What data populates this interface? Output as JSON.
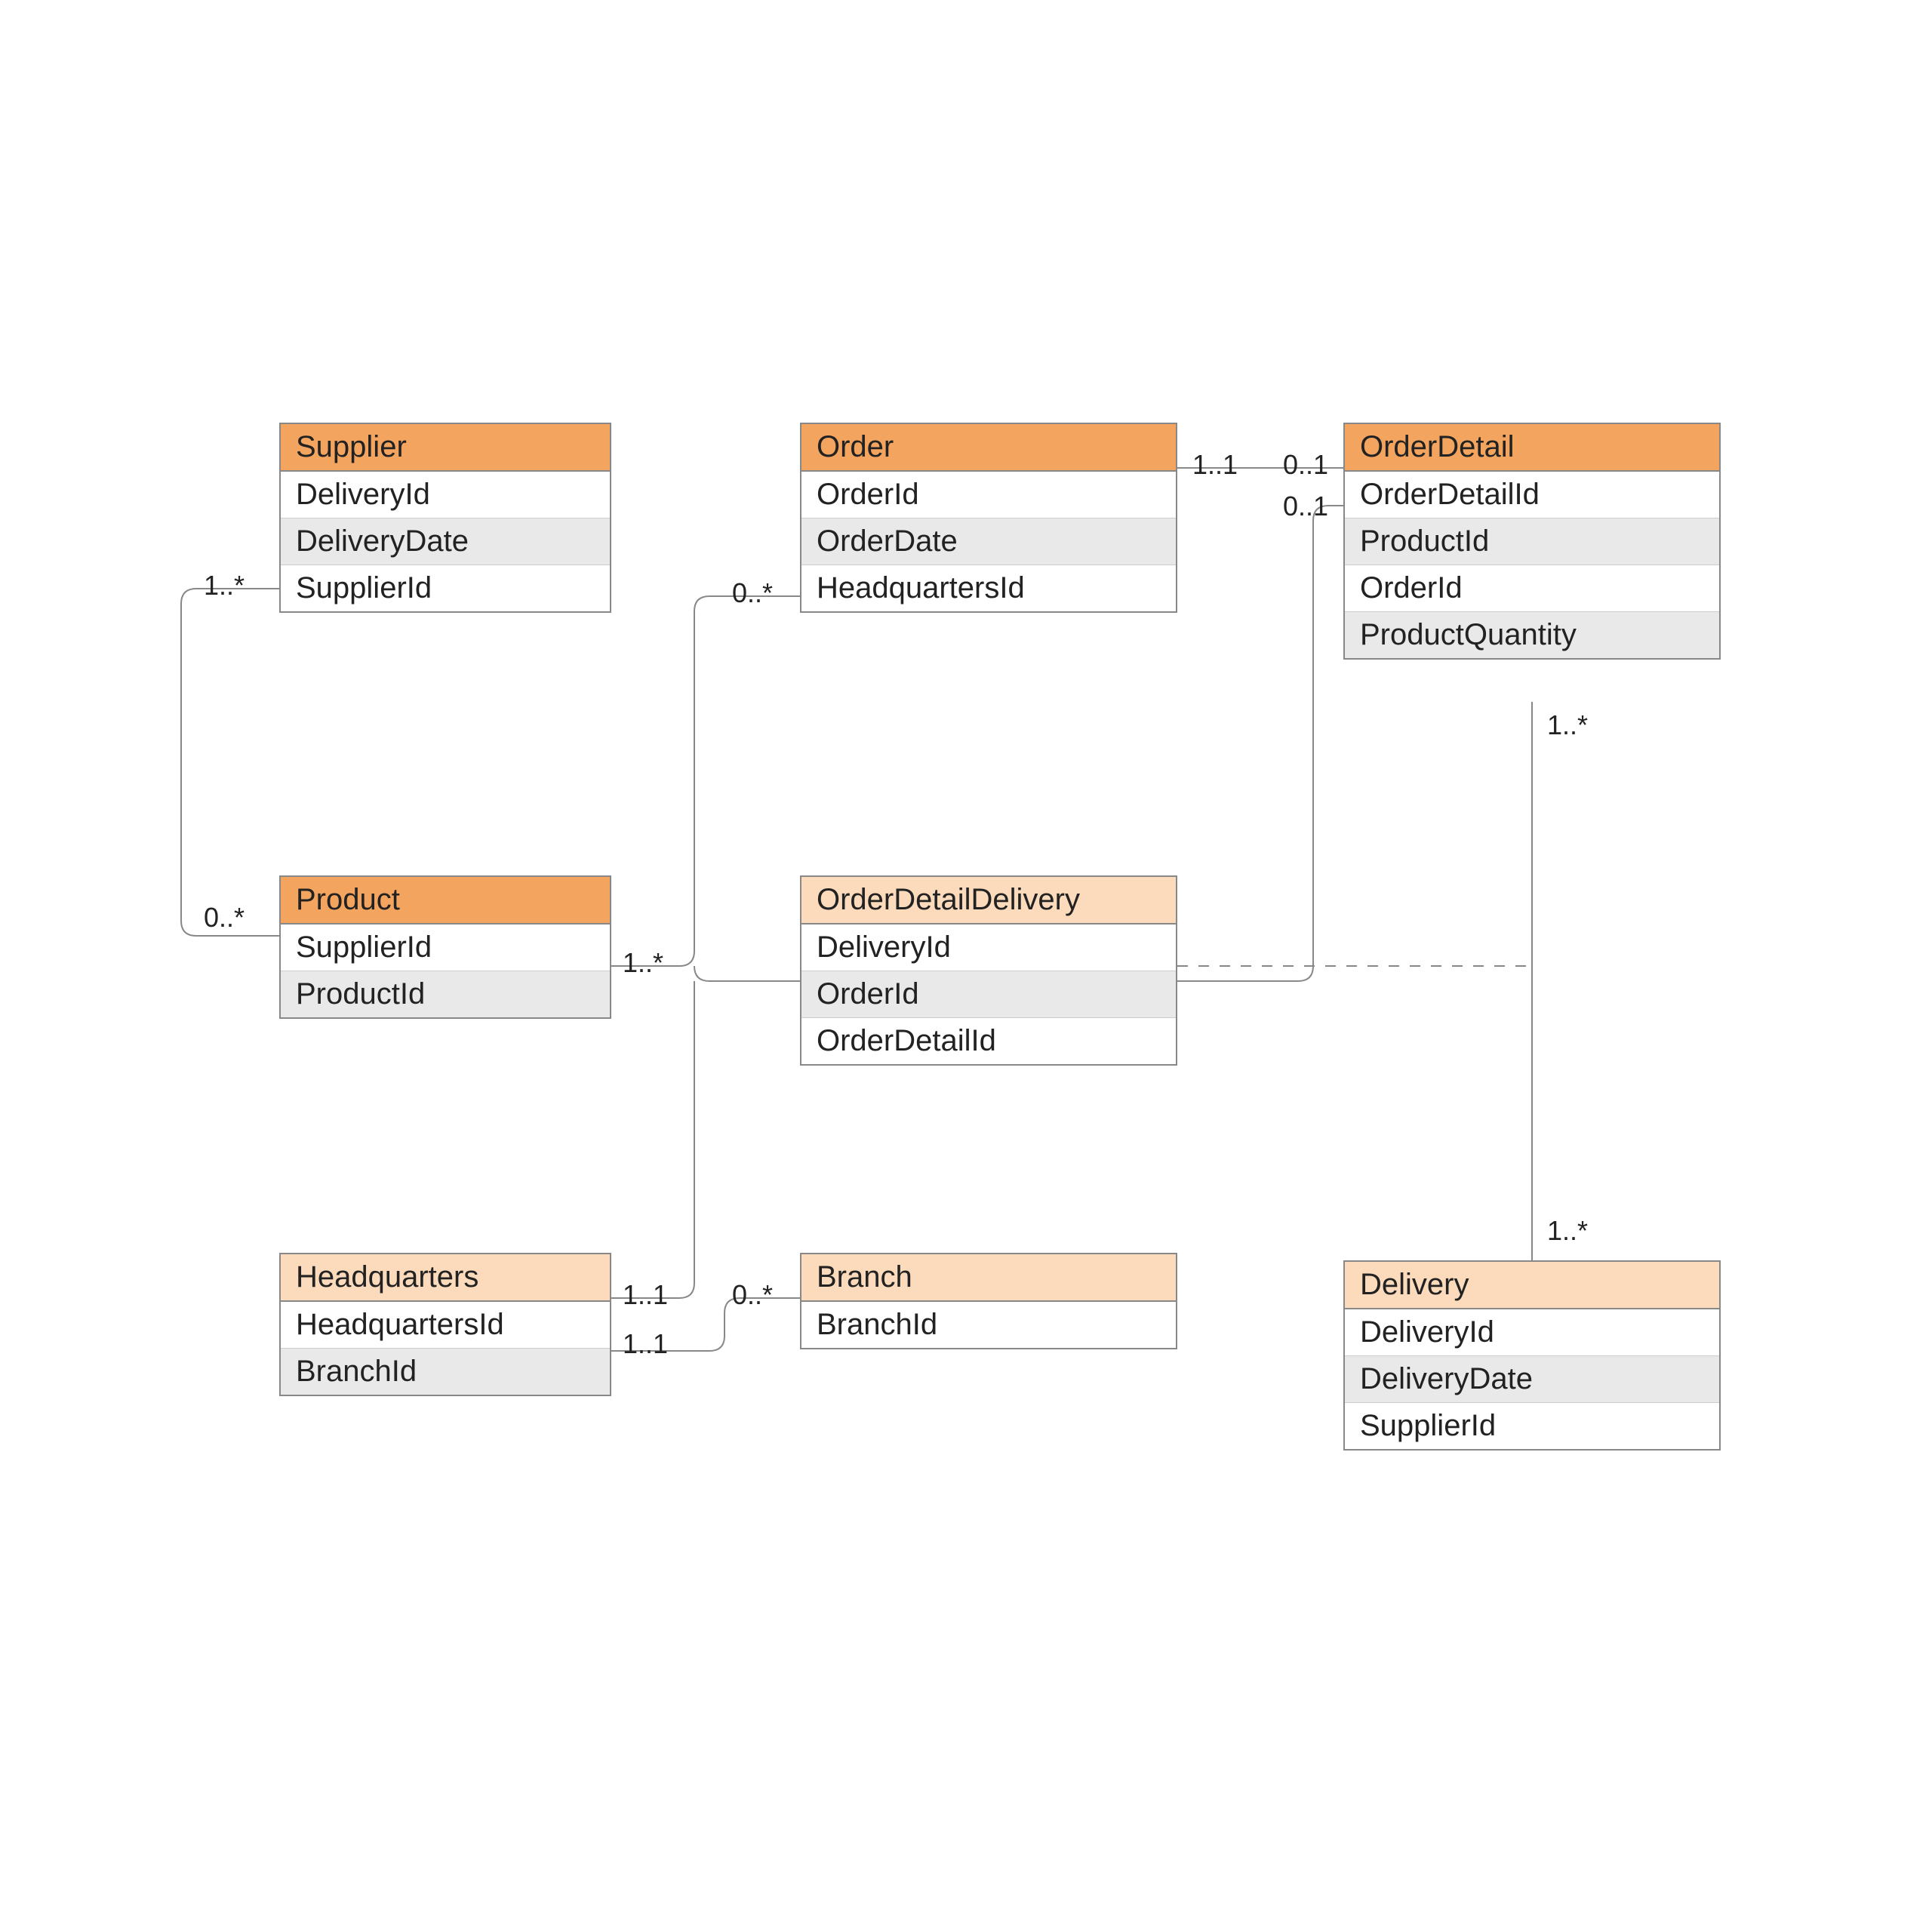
{
  "entities": {
    "supplier": {
      "title": "Supplier",
      "attrs": [
        "DeliveryId",
        "DeliveryDate",
        "SupplierId"
      ]
    },
    "order": {
      "title": "Order",
      "attrs": [
        "OrderId",
        "OrderDate",
        "HeadquartersId"
      ]
    },
    "orderDetail": {
      "title": "OrderDetail",
      "attrs": [
        "OrderDetailId",
        "ProductId",
        "OrderId",
        "ProductQuantity"
      ]
    },
    "product": {
      "title": "Product",
      "attrs": [
        "SupplierId",
        "ProductId"
      ]
    },
    "orderDetailDelivery": {
      "title": "OrderDetailDelivery",
      "attrs": [
        "DeliveryId",
        "OrderId",
        "OrderDetailId"
      ]
    },
    "headquarters": {
      "title": "Headquarters",
      "attrs": [
        "HeadquartersId",
        "BranchId"
      ]
    },
    "branch": {
      "title": "Branch",
      "attrs": [
        "BranchId"
      ]
    },
    "delivery": {
      "title": "Delivery",
      "attrs": [
        "DeliveryId",
        "DeliveryDate",
        "SupplierId"
      ]
    }
  },
  "cardinalities": {
    "supplier_out": "1..*",
    "product_in": "0..*",
    "product_out": "1..*",
    "order_in": "0..*",
    "order_to_od": "1..1",
    "od_from_order": "0..1",
    "od_from_prod": "0..1",
    "od_to_delivery": "1..*",
    "delivery_from_od": "1..*",
    "hq_to_branch": "1..1",
    "hq_to_order": "1..1",
    "branch_from_hq": "0..*"
  }
}
